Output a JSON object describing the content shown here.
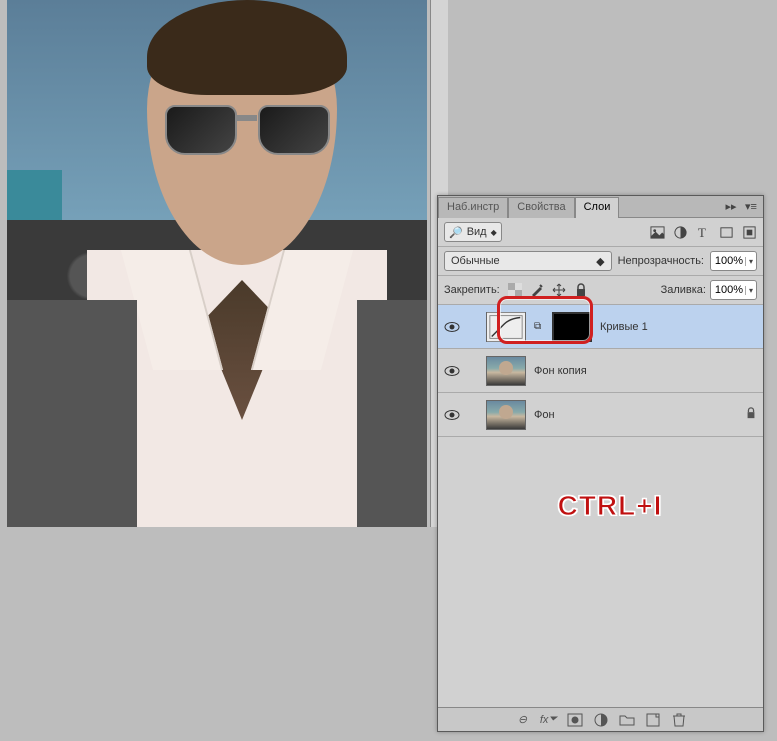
{
  "tabs": {
    "brushes": "Наб.инстр",
    "properties": "Свойства",
    "layers": "Слои"
  },
  "filter": {
    "label": "Вид"
  },
  "blend": {
    "mode": "Обычные",
    "opacity_label": "Непрозрачность:",
    "opacity_value": "100%"
  },
  "lock": {
    "label": "Закрепить:",
    "fill_label": "Заливка:",
    "fill_value": "100%"
  },
  "layers_list": [
    {
      "name": "Кривые 1",
      "type": "adjustment",
      "selected": true,
      "mask": "black"
    },
    {
      "name": "Фон копия",
      "type": "photo",
      "selected": false
    },
    {
      "name": "Фон",
      "type": "photo",
      "selected": false,
      "locked": true
    }
  ],
  "overlay_text": "CTRL+I",
  "icons": {
    "image": "image-icon",
    "adjust": "adjustment-icon",
    "type": "type-icon",
    "shape": "shape-icon",
    "smart": "smart-icon"
  },
  "chart_data": null
}
